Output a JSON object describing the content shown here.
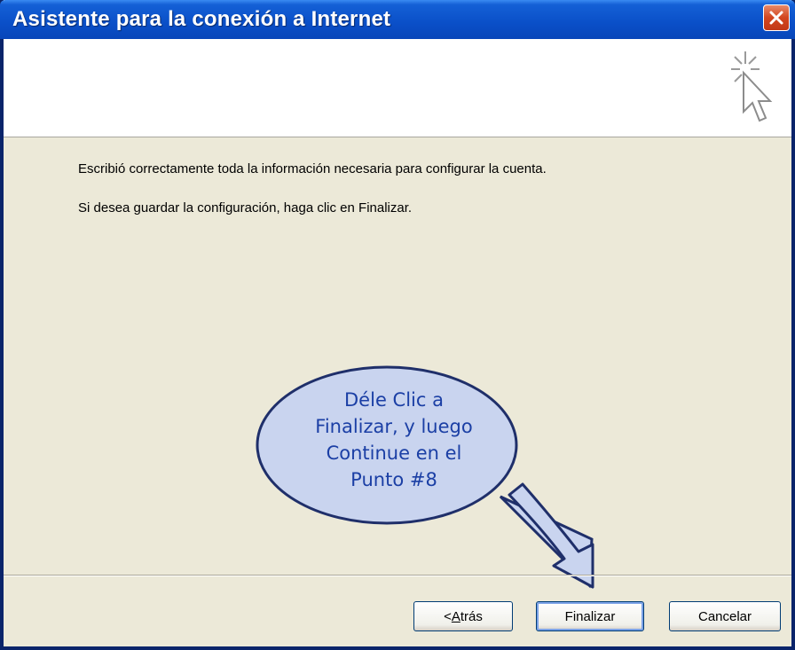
{
  "window": {
    "title": "Asistente para la conexión a Internet"
  },
  "content": {
    "message_1": "Escribió correctamente toda la información necesaria para configurar la cuenta.",
    "message_2": "Si desea guardar la configuración, haga clic en Finalizar."
  },
  "buttons": {
    "back_prefix": "< ",
    "back_accel": "A",
    "back_rest": "trás",
    "finish": "Finalizar",
    "cancel": "Cancelar"
  },
  "callout": {
    "line1": "Déle Clic a",
    "line2": "Finalizar, y luego",
    "line3": "Continue en el",
    "line4": "Punto #8"
  },
  "colors": {
    "titlebar": "#0A4FC8",
    "dialog_bg": "#ECE9D8",
    "callout_fill": "#C9D4EF",
    "callout_text": "#1B3FA5",
    "close_button": "#D2461F"
  },
  "icons": {
    "close": "close-icon",
    "wizard": "wizard-cursor-icon"
  }
}
